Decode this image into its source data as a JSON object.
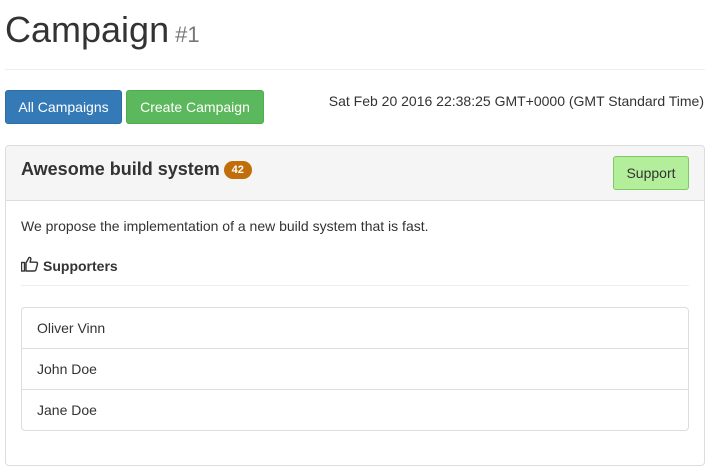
{
  "header": {
    "title": "Campaign",
    "subtitle": "#1"
  },
  "toolbar": {
    "all_campaigns_label": "All Campaigns",
    "create_campaign_label": "Create Campaign",
    "timestamp": "Sat Feb 20 2016 22:38:25 GMT+0000 (GMT Standard Time)"
  },
  "campaign": {
    "name": "Awesome build system",
    "support_count": "42",
    "support_button_label": "Support",
    "description": "We propose the implementation of a new build system that is fast.",
    "supporters_heading": "Supporters",
    "supporters_icon": "thumbs-up-icon",
    "supporters": [
      {
        "name": "Oliver Vinn"
      },
      {
        "name": "John Doe"
      },
      {
        "name": "Jane Doe"
      }
    ]
  },
  "colors": {
    "primary": "#337ab7",
    "success": "#5cb85c",
    "support_button": "#b3ee9a",
    "badge": "#c06d0a"
  }
}
